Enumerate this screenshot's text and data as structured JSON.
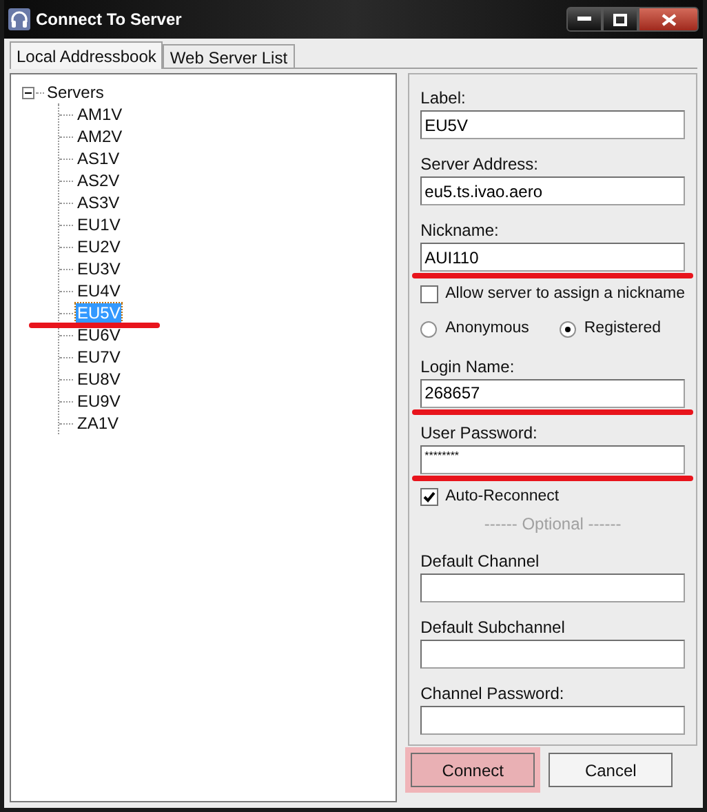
{
  "window": {
    "title": "Connect To Server"
  },
  "tabs": [
    {
      "label": "Local Addressbook",
      "selected": true
    },
    {
      "label": "Web Server List",
      "selected": false
    }
  ],
  "tree": {
    "label": "Servers",
    "expanded": true,
    "children": [
      {
        "label": "AM1V",
        "selected": false,
        "underlined": false
      },
      {
        "label": "AM2V",
        "selected": false,
        "underlined": false
      },
      {
        "label": "AS1V",
        "selected": false,
        "underlined": false
      },
      {
        "label": "AS2V",
        "selected": false,
        "underlined": false
      },
      {
        "label": "AS3V",
        "selected": false,
        "underlined": false
      },
      {
        "label": "EU1V",
        "selected": false,
        "underlined": false
      },
      {
        "label": "EU2V",
        "selected": false,
        "underlined": false
      },
      {
        "label": "EU3V",
        "selected": false,
        "underlined": false
      },
      {
        "label": "EU4V",
        "selected": false,
        "underlined": false
      },
      {
        "label": "EU5V",
        "selected": true,
        "underlined": true
      },
      {
        "label": "EU6V",
        "selected": false,
        "underlined": false
      },
      {
        "label": "EU7V",
        "selected": false,
        "underlined": false
      },
      {
        "label": "EU8V",
        "selected": false,
        "underlined": false
      },
      {
        "label": "EU9V",
        "selected": false,
        "underlined": false
      },
      {
        "label": "ZA1V",
        "selected": false,
        "underlined": false
      }
    ]
  },
  "form": [
    {
      "kind": "field",
      "label": "Label:",
      "value": "EU5V"
    },
    {
      "kind": "field",
      "label": "Server Address:",
      "value": "eu5.ts.ivao.aero"
    },
    {
      "kind": "field",
      "label": "Nickname:",
      "value": "AUI110",
      "underlined": true
    },
    {
      "kind": "checkbox",
      "label": "Allow server to assign a nickname",
      "checked": false
    },
    {
      "kind": "radios",
      "options": [
        {
          "label": "Anonymous",
          "selected": false
        },
        {
          "label": "Registered",
          "selected": true
        }
      ]
    },
    {
      "kind": "field",
      "label": "Login Name:",
      "value": "268657",
      "underlined": true
    },
    {
      "kind": "password",
      "label": "User Password:",
      "value": "********",
      "underlined": true
    },
    {
      "kind": "checkbox",
      "label": "Auto-Reconnect",
      "checked": true
    },
    {
      "kind": "separator",
      "label": "------ Optional ------"
    },
    {
      "kind": "field",
      "label": "Default Channel"
    },
    {
      "kind": "field",
      "label": "Default Subchannel"
    },
    {
      "kind": "field",
      "label": "Channel Password:"
    }
  ],
  "buttons": [
    {
      "label": "Connect",
      "highlighted": true
    },
    {
      "label": "Cancel",
      "highlighted": false
    }
  ]
}
